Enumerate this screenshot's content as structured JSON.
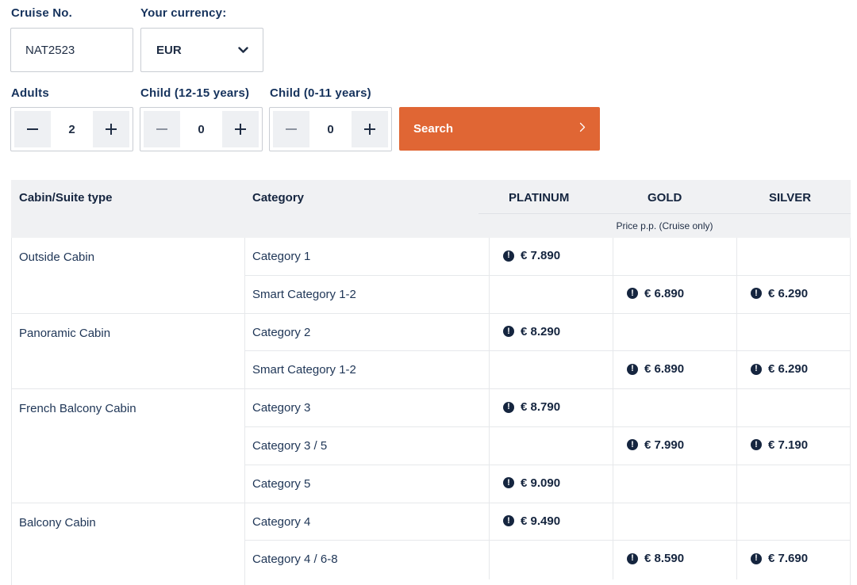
{
  "form": {
    "cruise_no_label": "Cruise No.",
    "cruise_no_value": "NAT2523",
    "currency_label": "Your currency:",
    "currency_value": "EUR",
    "adults_label": "Adults",
    "adults_value": "2",
    "child_12_15_label": "Child (12-15 years)",
    "child_12_15_value": "0",
    "child_0_11_label": "Child (0-11 years)",
    "child_0_11_value": "0",
    "search_label": "Search",
    "search_arrow": "›"
  },
  "table": {
    "headers": {
      "cabin": "Cabin/Suite type",
      "category": "Category",
      "platinum": "PLATINUM",
      "gold": "GOLD",
      "silver": "SILVER",
      "price_note": "Price p.p. (Cruise only)"
    },
    "groups": [
      {
        "name": "Outside Cabin",
        "rows": [
          {
            "category": "Category 1",
            "platinum": "€ 7.890",
            "gold": "",
            "silver": ""
          },
          {
            "category": "Smart Category 1-2",
            "platinum": "",
            "gold": "€ 6.890",
            "silver": "€ 6.290"
          }
        ]
      },
      {
        "name": "Panoramic Cabin",
        "rows": [
          {
            "category": "Category 2",
            "platinum": "€ 8.290",
            "gold": "",
            "silver": ""
          },
          {
            "category": "Smart Category 1-2",
            "platinum": "",
            "gold": "€ 6.890",
            "silver": "€ 6.290"
          }
        ]
      },
      {
        "name": "French Balcony Cabin",
        "rows": [
          {
            "category": "Category 3",
            "platinum": "€ 8.790",
            "gold": "",
            "silver": ""
          },
          {
            "category": "Category 3 / 5",
            "platinum": "",
            "gold": "€ 7.990",
            "silver": "€ 7.190"
          },
          {
            "category": "Category 5",
            "platinum": "€ 9.090",
            "gold": "",
            "silver": ""
          }
        ]
      },
      {
        "name": "Balcony Cabin",
        "rows": [
          {
            "category": "Category 4",
            "platinum": "€ 9.490",
            "gold": "",
            "silver": ""
          },
          {
            "category": "Category 4 / 6-8",
            "platinum": "",
            "gold": "€ 8.590",
            "silver": "€ 7.690"
          }
        ]
      }
    ]
  },
  "icons": {
    "info": "!"
  }
}
